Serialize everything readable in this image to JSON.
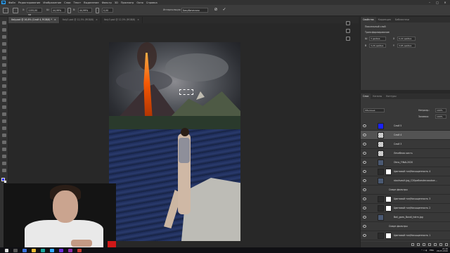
{
  "app": {
    "logo_text": "Ps"
  },
  "menu": [
    "Файл",
    "Редактирование",
    "Изображение",
    "Слои",
    "Текст",
    "Выделение",
    "Фильтр",
    "3D",
    "Просмотр",
    "Окно",
    "Справка"
  ],
  "window_controls": {
    "minimize": "–",
    "maximize": "□",
    "close": "✕"
  },
  "options_bar": {
    "x_label": "X:",
    "x_value": "1155,00 пи",
    "w_label": "Ш:",
    "w_value": "44,99%",
    "h_label": "В:",
    "h_value": "44,99%",
    "angle_value": "0,00",
    "interpolation_label": "Интерполяция:",
    "interpolation_value": "Бикубическая",
    "cancel_symbol": "⊘",
    "commit_symbol": "✓"
  },
  "tabs": [
    {
      "label": "Italy.psd @ 16,6% (Слой 4, RGB/8) *",
      "active": true
    },
    {
      "label": "Italy2.psd @ 12,5% (RGB/8)",
      "active": false
    },
    {
      "label": "Italy3.psd @ 12,5% (RGB/8)",
      "active": false
    }
  ],
  "properties_panel": {
    "tabs": [
      "Свойства",
      "Коррекция",
      "Библиотеки"
    ],
    "title": "Пиксельный слой",
    "section": "Трансформирование",
    "w_label": "Ш",
    "w_value": "3 дюйма",
    "x_label": "X",
    "x_value": "0,22 дюйма",
    "h_label": "В",
    "h_value": "3,29 дюйма",
    "y_label": "Y",
    "y_value": "3,65 дюйма"
  },
  "layers_panel": {
    "tabs": [
      "Слои",
      "Каналы",
      "Контуры"
    ],
    "blend_mode": "Обычные",
    "opacity_label": "Непрозр.:",
    "opacity_value": "100%",
    "fill_label": "Заливка:",
    "fill_value": "100%",
    "layers": [
      {
        "name": "Слой 5",
        "selected": false,
        "thumb": "blue"
      },
      {
        "name": "Слой 4",
        "selected": true,
        "thumb": "checker"
      },
      {
        "name": "Слой 3",
        "selected": false,
        "thumb": "checker"
      },
      {
        "name": "Лечебная кисть",
        "selected": false,
        "thumb": "checker"
      },
      {
        "name": "Okno_FINAL2020",
        "selected": false,
        "thumb": "photo"
      },
      {
        "name": "Цветовой тон/Насыщенность 4",
        "selected": false,
        "thumb": "adjust"
      },
      {
        "name": "stockvault.jpg_C20pa6xeutecoaukoe...",
        "selected": false,
        "thumb": "photo"
      },
      {
        "name": "Смарт-фильтры",
        "selected": false,
        "thumb": "none",
        "sub": true
      },
      {
        "name": "Цветовой тон/Насыщенность 3",
        "selected": false,
        "thumb": "adjust",
        "sub": true
      },
      {
        "name": "Цветовой тон/Насыщенность 2",
        "selected": false,
        "thumb": "adjust"
      },
      {
        "name": "Bali_goes_Bondi_hdrm.jpg",
        "selected": false,
        "thumb": "photo"
      },
      {
        "name": "Смарт-фильтры",
        "selected": false,
        "thumb": "none",
        "sub": true
      },
      {
        "name": "Цветовой тон/Насыщенность 1",
        "selected": false,
        "thumb": "adjust",
        "sub": true
      }
    ]
  },
  "taskbar": {
    "lang": "ENG",
    "time": "21:26",
    "date": "26.05.2020"
  },
  "colors": {
    "foreground": "#1a22ff",
    "background": "#ffffff",
    "accent": "#31a8ff"
  }
}
